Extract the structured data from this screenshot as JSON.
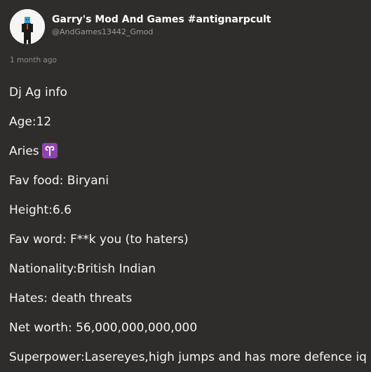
{
  "post": {
    "author": {
      "name": "Garry's Mod And Games #antignarpcult",
      "handle": "@AndGames13442_Gmod"
    },
    "timestamp": "1 month ago",
    "lines": [
      "Dj Ag info",
      "Age:12",
      "Aries",
      "Fav food: Biryani",
      "Height:6.6",
      "Fav word: F**k you (to haters)",
      "Nationality:British Indian",
      "Hates: death threats",
      "Net worth: 56,000,000,000,000",
      "Superpower:Lasereyes,high jumps and has more defence iq"
    ],
    "aries_emoji_icon": "aries-zodiac-icon",
    "colors": {
      "background": "#2f2d2c",
      "text": "#f4f4f4",
      "muted": "#8f8c8a",
      "emoji_bg": "#8e44ad"
    }
  }
}
